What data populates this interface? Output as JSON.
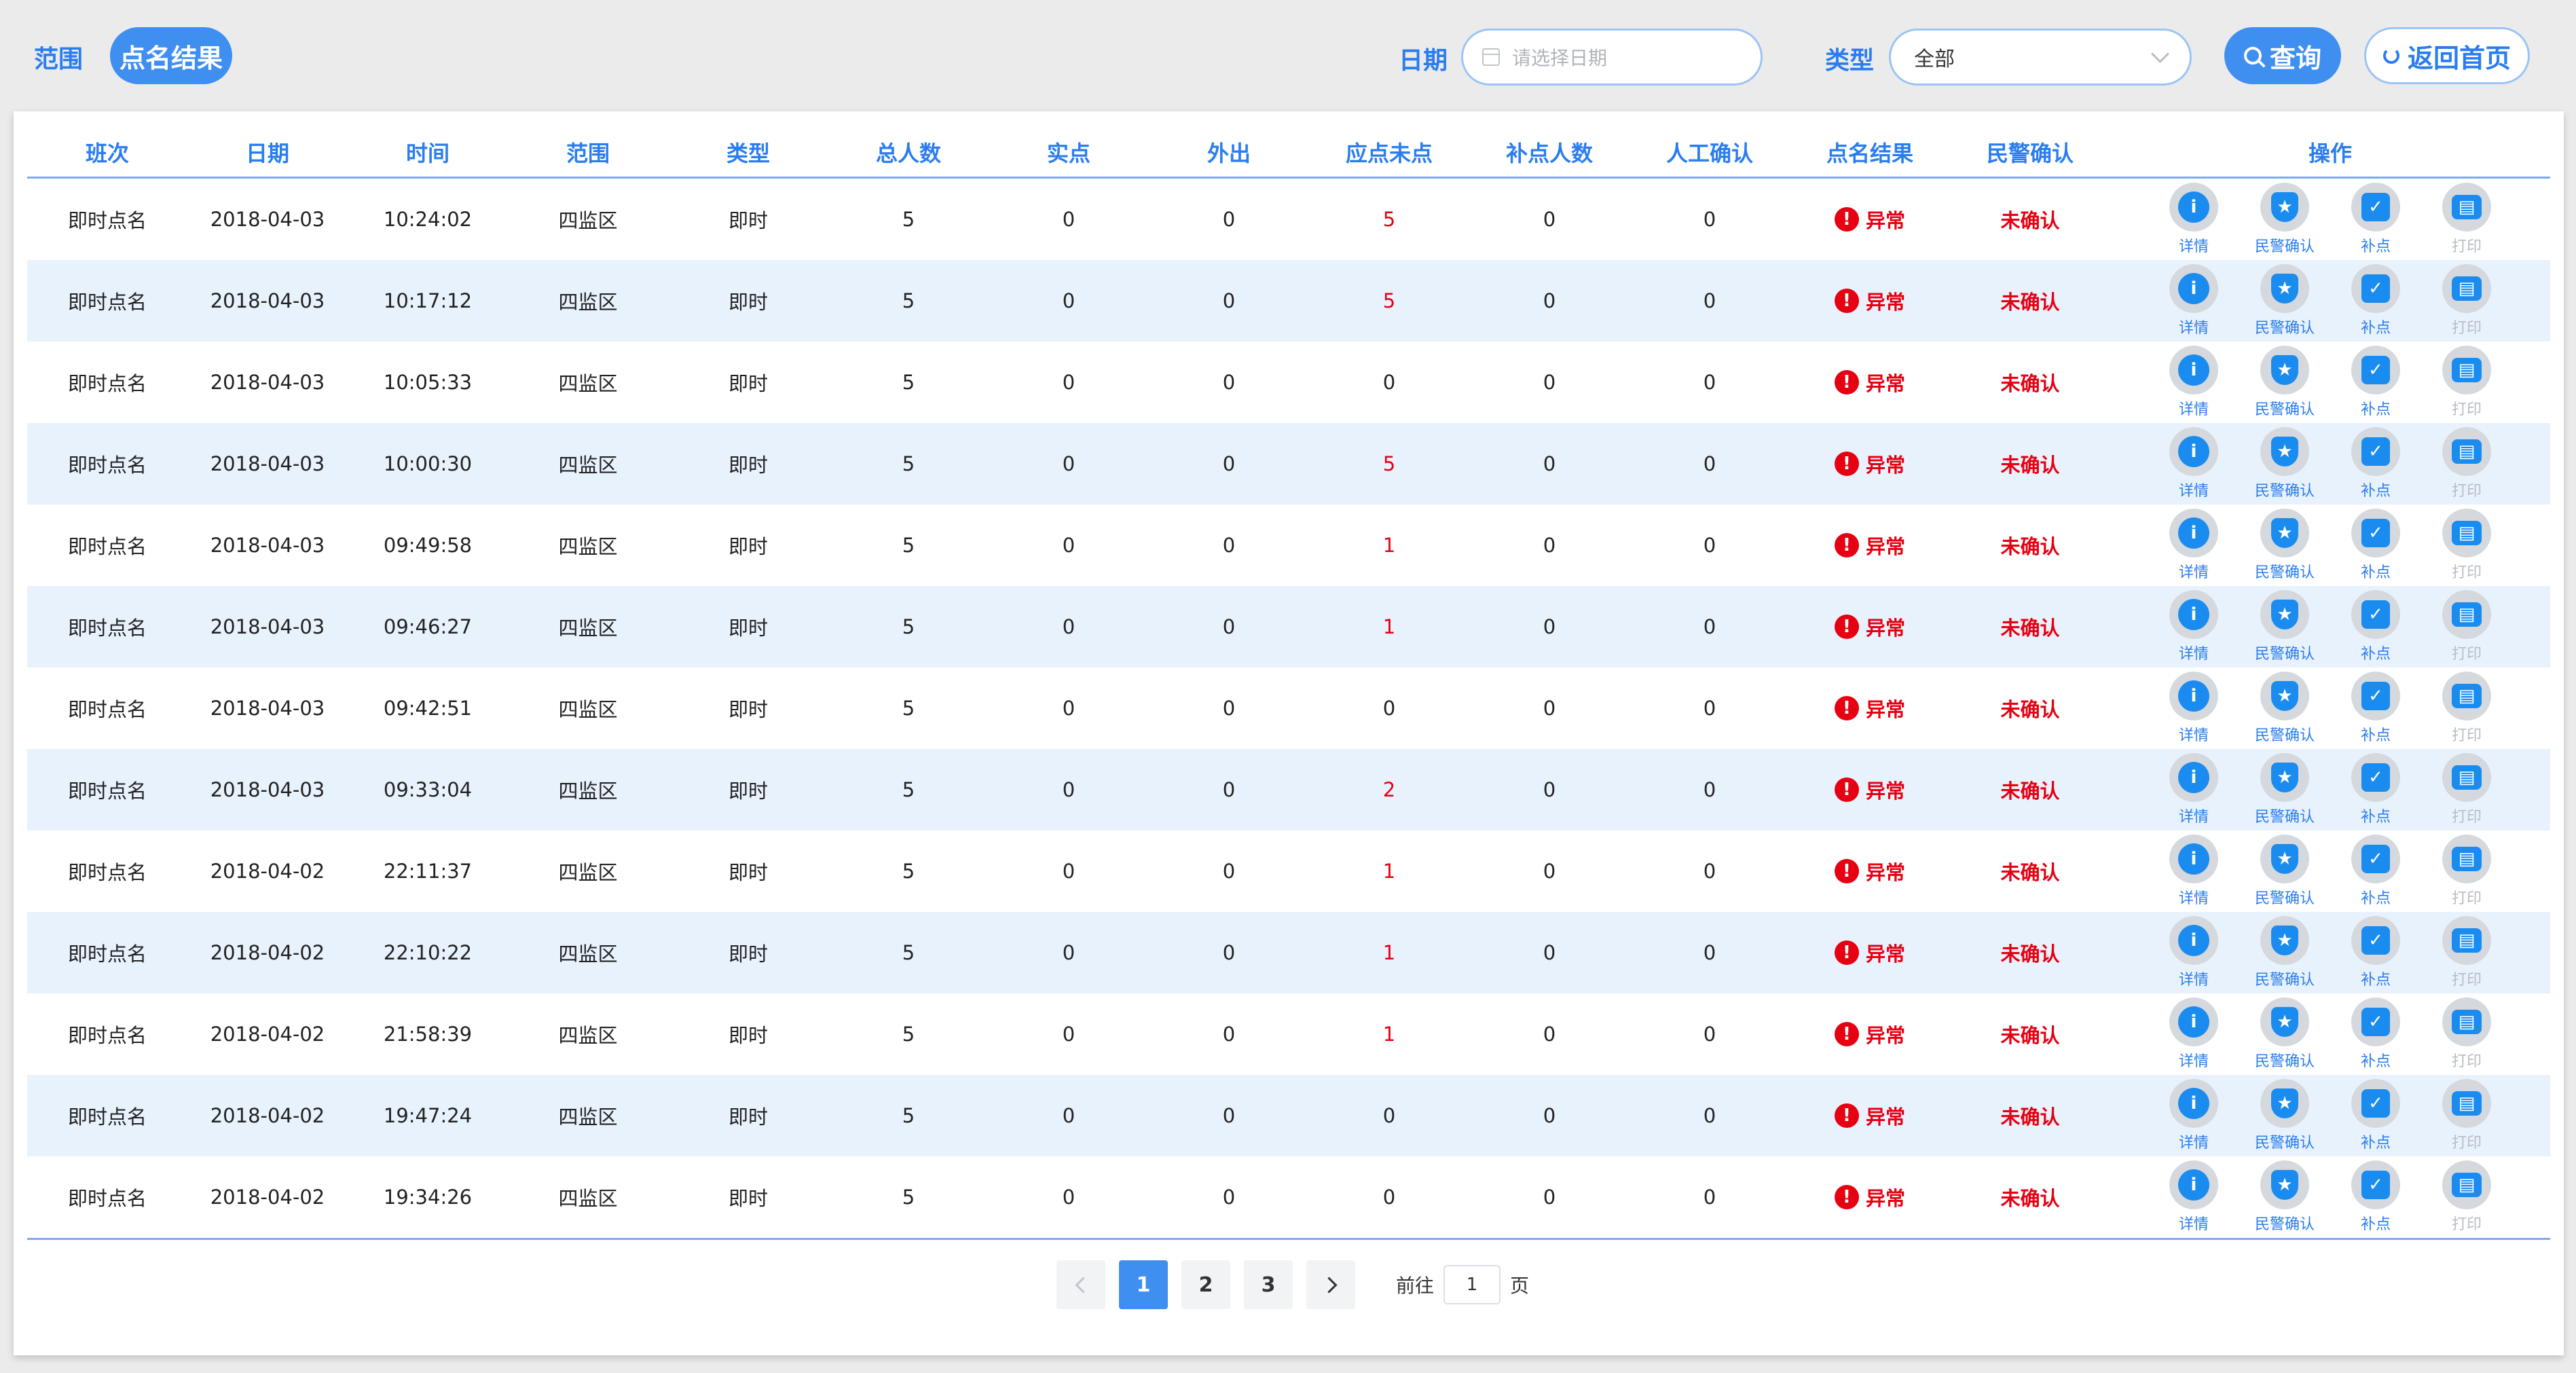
{
  "nav": {
    "scope_link": "范围",
    "active_tab": "点名结果"
  },
  "filters": {
    "date_label": "日期",
    "date_placeholder": "请选择日期",
    "type_label": "类型",
    "type_value": "全部"
  },
  "buttons": {
    "query": "查询",
    "home": "返回首页"
  },
  "table": {
    "headers": [
      "班次",
      "日期",
      "时间",
      "范围",
      "类型",
      "总人数",
      "实点",
      "外出",
      "应点未点",
      "补点人数",
      "人工确认",
      "点名结果",
      "民警确认",
      "操作"
    ],
    "ops_labels": {
      "detail": "详情",
      "police_confirm": "民警确认",
      "supplement": "补点",
      "print": "打印"
    },
    "rows": [
      {
        "shift": "即时点名",
        "date": "2018-04-03",
        "time": "10:24:02",
        "scope": "四监区",
        "type": "即时",
        "total": "5",
        "actual": "0",
        "out": "0",
        "missing": "5",
        "supp": "0",
        "manual": "0",
        "result": "异常",
        "police": "未确认"
      },
      {
        "shift": "即时点名",
        "date": "2018-04-03",
        "time": "10:17:12",
        "scope": "四监区",
        "type": "即时",
        "total": "5",
        "actual": "0",
        "out": "0",
        "missing": "5",
        "supp": "0",
        "manual": "0",
        "result": "异常",
        "police": "未确认"
      },
      {
        "shift": "即时点名",
        "date": "2018-04-03",
        "time": "10:05:33",
        "scope": "四监区",
        "type": "即时",
        "total": "5",
        "actual": "0",
        "out": "0",
        "missing": "0",
        "supp": "0",
        "manual": "0",
        "result": "异常",
        "police": "未确认"
      },
      {
        "shift": "即时点名",
        "date": "2018-04-03",
        "time": "10:00:30",
        "scope": "四监区",
        "type": "即时",
        "total": "5",
        "actual": "0",
        "out": "0",
        "missing": "5",
        "supp": "0",
        "manual": "0",
        "result": "异常",
        "police": "未确认"
      },
      {
        "shift": "即时点名",
        "date": "2018-04-03",
        "time": "09:49:58",
        "scope": "四监区",
        "type": "即时",
        "total": "5",
        "actual": "0",
        "out": "0",
        "missing": "1",
        "supp": "0",
        "manual": "0",
        "result": "异常",
        "police": "未确认"
      },
      {
        "shift": "即时点名",
        "date": "2018-04-03",
        "time": "09:46:27",
        "scope": "四监区",
        "type": "即时",
        "total": "5",
        "actual": "0",
        "out": "0",
        "missing": "1",
        "supp": "0",
        "manual": "0",
        "result": "异常",
        "police": "未确认"
      },
      {
        "shift": "即时点名",
        "date": "2018-04-03",
        "time": "09:42:51",
        "scope": "四监区",
        "type": "即时",
        "total": "5",
        "actual": "0",
        "out": "0",
        "missing": "0",
        "supp": "0",
        "manual": "0",
        "result": "异常",
        "police": "未确认"
      },
      {
        "shift": "即时点名",
        "date": "2018-04-03",
        "time": "09:33:04",
        "scope": "四监区",
        "type": "即时",
        "total": "5",
        "actual": "0",
        "out": "0",
        "missing": "2",
        "supp": "0",
        "manual": "0",
        "result": "异常",
        "police": "未确认"
      },
      {
        "shift": "即时点名",
        "date": "2018-04-02",
        "time": "22:11:37",
        "scope": "四监区",
        "type": "即时",
        "total": "5",
        "actual": "0",
        "out": "0",
        "missing": "1",
        "supp": "0",
        "manual": "0",
        "result": "异常",
        "police": "未确认"
      },
      {
        "shift": "即时点名",
        "date": "2018-04-02",
        "time": "22:10:22",
        "scope": "四监区",
        "type": "即时",
        "total": "5",
        "actual": "0",
        "out": "0",
        "missing": "1",
        "supp": "0",
        "manual": "0",
        "result": "异常",
        "police": "未确认"
      },
      {
        "shift": "即时点名",
        "date": "2018-04-02",
        "time": "21:58:39",
        "scope": "四监区",
        "type": "即时",
        "total": "5",
        "actual": "0",
        "out": "0",
        "missing": "1",
        "supp": "0",
        "manual": "0",
        "result": "异常",
        "police": "未确认"
      },
      {
        "shift": "即时点名",
        "date": "2018-04-02",
        "time": "19:47:24",
        "scope": "四监区",
        "type": "即时",
        "total": "5",
        "actual": "0",
        "out": "0",
        "missing": "0",
        "supp": "0",
        "manual": "0",
        "result": "异常",
        "police": "未确认"
      },
      {
        "shift": "即时点名",
        "date": "2018-04-02",
        "time": "19:34:26",
        "scope": "四监区",
        "type": "即时",
        "total": "5",
        "actual": "0",
        "out": "0",
        "missing": "0",
        "supp": "0",
        "manual": "0",
        "result": "异常",
        "police": "未确认"
      }
    ]
  },
  "pagination": {
    "pages": [
      "1",
      "2",
      "3"
    ],
    "current": "1",
    "goto_prefix": "前往",
    "goto_value": "1",
    "goto_suffix": "页"
  },
  "colors": {
    "accent": "#3f8ff1",
    "alert": "#e60012",
    "row_alt": "#e8f2fd"
  }
}
